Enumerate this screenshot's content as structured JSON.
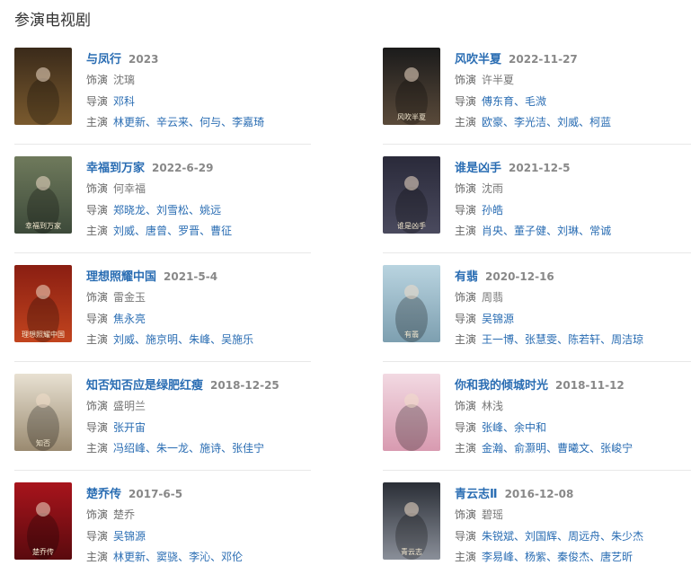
{
  "section": {
    "title": "参演电视剧"
  },
  "labels": {
    "role": "饰演",
    "director": "导演",
    "cast": "主演"
  },
  "works": [
    {
      "title": "与凤行",
      "year": "2023",
      "role": "沈璃",
      "directors": [
        "邓科"
      ],
      "cast": [
        "林更新",
        "辛云来",
        "何与",
        "李嘉琦"
      ],
      "poster_colors": [
        "#3a2a1a",
        "#7a5a2e"
      ],
      "poster_text": ""
    },
    {
      "title": "风吹半夏",
      "year": "2022-11-27",
      "role": "许半夏",
      "directors": [
        "傅东育",
        "毛溦"
      ],
      "cast": [
        "欧豪",
        "李光洁",
        "刘威",
        "柯蓝"
      ],
      "poster_colors": [
        "#1b1b1b",
        "#5a4a3a"
      ],
      "poster_text": "风吹半夏"
    },
    {
      "title": "幸福到万家",
      "year": "2022-6-29",
      "role": "何幸福",
      "directors": [
        "郑晓龙",
        "刘雪松",
        "姚远"
      ],
      "cast": [
        "刘威",
        "唐曾",
        "罗晋",
        "曹征"
      ],
      "poster_colors": [
        "#6f7a5c",
        "#3d4a3a"
      ],
      "poster_text": "幸福到万家"
    },
    {
      "title": "谁是凶手",
      "year": "2021-12-5",
      "role": "沈雨",
      "directors": [
        "孙皓"
      ],
      "cast": [
        "肖央",
        "董子健",
        "刘琳",
        "常诚"
      ],
      "poster_colors": [
        "#2a2a3a",
        "#4a4a5e"
      ],
      "poster_text": "谁是凶手"
    },
    {
      "title": "理想照耀中国",
      "year": "2021-5-4",
      "role": "雷金玉",
      "directors": [
        "焦永亮"
      ],
      "cast": [
        "刘威",
        "施京明",
        "朱峰",
        "吴施乐"
      ],
      "poster_colors": [
        "#8a1e12",
        "#c2441e"
      ],
      "poster_text": "理想照耀中国"
    },
    {
      "title": "有翡",
      "year": "2020-12-16",
      "role": "周翡",
      "directors": [
        "吴锦源"
      ],
      "cast": [
        "王一博",
        "张慧雯",
        "陈若轩",
        "周洁琼"
      ],
      "poster_colors": [
        "#b9d4e0",
        "#7d9fb0"
      ],
      "poster_text": "有翡"
    },
    {
      "title": "知否知否应是绿肥红瘦",
      "year": "2018-12-25",
      "role": "盛明兰",
      "directors": [
        "张开宙"
      ],
      "cast": [
        "冯绍峰",
        "朱一龙",
        "施诗",
        "张佳宁"
      ],
      "poster_colors": [
        "#e8e1d2",
        "#9a8a70"
      ],
      "poster_text": "知否"
    },
    {
      "title": "你和我的倾城时光",
      "year": "2018-11-12",
      "role": "林浅",
      "directors": [
        "张峰",
        "余中和"
      ],
      "cast": [
        "金瀚",
        "俞灏明",
        "曹曦文",
        "张峻宁"
      ],
      "poster_colors": [
        "#f2d9e2",
        "#d89ab0"
      ],
      "poster_text": ""
    },
    {
      "title": "楚乔传",
      "year": "2017-6-5",
      "role": "楚乔",
      "directors": [
        "吴锦源"
      ],
      "cast": [
        "林更新",
        "窦骁",
        "李沁",
        "邓伦"
      ],
      "poster_colors": [
        "#a8141c",
        "#5a0a0e"
      ],
      "poster_text": "楚乔传"
    },
    {
      "title": "青云志Ⅱ",
      "year": "2016-12-08",
      "role": "碧瑶",
      "directors": [
        "朱锐斌",
        "刘国辉",
        "周远舟",
        "朱少杰"
      ],
      "cast": [
        "李易峰",
        "杨紫",
        "秦俊杰",
        "唐艺昕"
      ],
      "poster_colors": [
        "#2a2e36",
        "#8a8f99"
      ],
      "poster_text": "青云志"
    }
  ]
}
